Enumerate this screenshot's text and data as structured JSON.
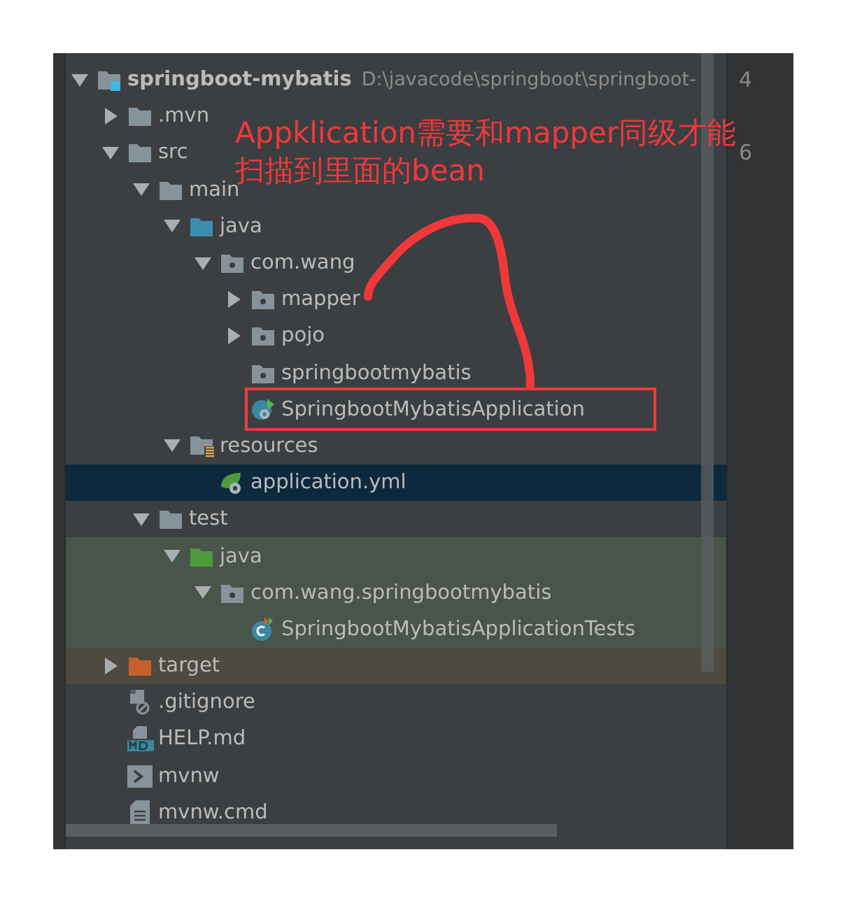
{
  "tree": [
    {
      "name": "springboot-mybatis",
      "path": "D:\\javacode\\springboot\\springboot-",
      "kind": "module",
      "expanded": true,
      "selected": false,
      "children": [
        {
          "name": ".mvn",
          "kind": "folder",
          "expanded": false,
          "selected": false
        },
        {
          "name": "src",
          "kind": "folder",
          "expanded": true,
          "selected": false,
          "children": [
            {
              "name": "main",
              "kind": "folder",
              "expanded": true,
              "selected": false,
              "children": [
                {
                  "name": "java",
                  "kind": "source-folder",
                  "expanded": true,
                  "selected": false,
                  "children": [
                    {
                      "name": "com.wang",
                      "kind": "package",
                      "expanded": true,
                      "selected": false,
                      "children": [
                        {
                          "name": "mapper",
                          "kind": "package",
                          "expanded": false,
                          "selected": false
                        },
                        {
                          "name": "pojo",
                          "kind": "package",
                          "expanded": false,
                          "selected": false
                        },
                        {
                          "name": "springbootmybatis",
                          "kind": "package",
                          "selected": false
                        },
                        {
                          "name": "SpringbootMybatisApplication",
                          "kind": "spring-class",
                          "selected": false
                        }
                      ]
                    }
                  ]
                },
                {
                  "name": "resources",
                  "kind": "resources",
                  "expanded": true,
                  "selected": false,
                  "children": [
                    {
                      "name": "application.yml",
                      "kind": "spring-config",
                      "selected": true
                    }
                  ]
                }
              ]
            },
            {
              "name": "test",
              "kind": "folder",
              "expanded": true,
              "selected": false,
              "children": [
                {
                  "name": "java",
                  "kind": "test-folder",
                  "test_scope": true,
                  "expanded": true,
                  "selected": false,
                  "children": [
                    {
                      "name": "com.wang.springbootmybatis",
                      "kind": "package",
                      "test_scope": true,
                      "expanded": true,
                      "selected": false,
                      "children": [
                        {
                          "name": "SpringbootMybatisApplicationTests",
                          "kind": "test-class",
                          "test_scope": true,
                          "selected": false
                        }
                      ]
                    }
                  ]
                }
              ]
            }
          ]
        },
        {
          "name": "target",
          "kind": "excluded-folder",
          "excluded": true,
          "expanded": false,
          "selected": false
        },
        {
          "name": ".gitignore",
          "kind": "ignore-file",
          "selected": false
        },
        {
          "name": "HELP.md",
          "kind": "markdown",
          "selected": false
        },
        {
          "name": "mvnw",
          "kind": "shell",
          "selected": false
        },
        {
          "name": "mvnw.cmd",
          "kind": "text-file",
          "selected": false
        }
      ]
    }
  ],
  "gutter_lines": [
    "4",
    "6"
  ],
  "annotation": {
    "lines": [
      "Appklication需要和mapper同级才能",
      "扫描到里面的bean"
    ]
  }
}
